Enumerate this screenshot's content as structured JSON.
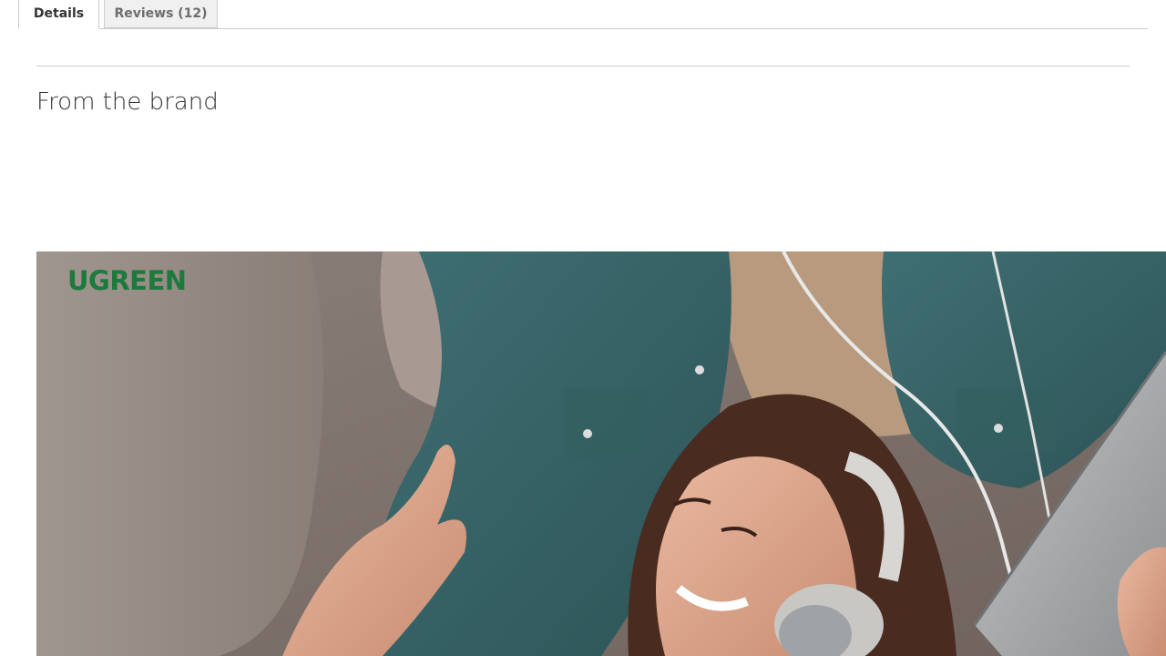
{
  "tabs": [
    {
      "label": "Details",
      "active": true
    },
    {
      "label": "Reviews (12)",
      "active": false
    }
  ],
  "section": {
    "title": "From the brand"
  },
  "hero": {
    "brand_logo_text": "UGREEN",
    "brand_color": "#1c7a3c"
  }
}
